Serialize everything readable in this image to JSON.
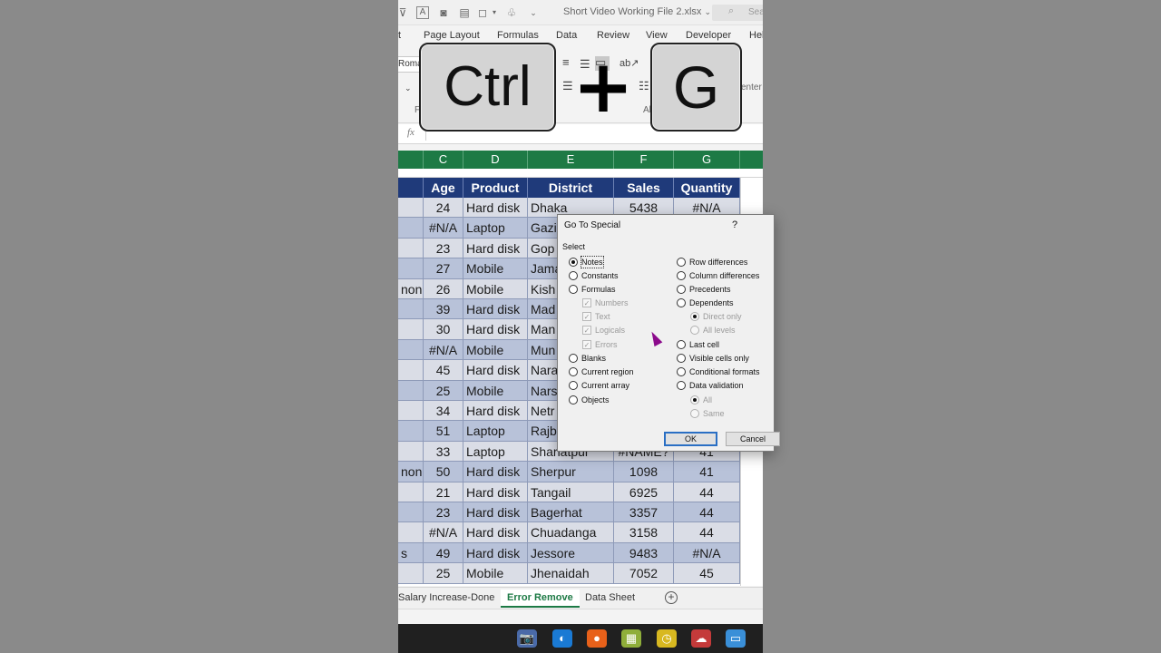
{
  "titlebar": {
    "filename": "Short Video Working File 2.xlsx",
    "dropdown_icon": "chevron-down-icon",
    "search_icon": "search-icon",
    "search_label": "Sear"
  },
  "ribbon_tabs": [
    "t",
    "Page Layout",
    "Formulas",
    "Data",
    "Review",
    "View",
    "Developer",
    "Hel"
  ],
  "ribbon": {
    "font_name": "Roma",
    "group_label_left": "F",
    "group_label_mid": "Al",
    "center_label": "enter"
  },
  "keys": {
    "ctrl": "Ctrl",
    "plus": "+",
    "g": "G"
  },
  "formula_bar": {
    "fx": "fx"
  },
  "columns": [
    "C",
    "D",
    "E",
    "F",
    "G"
  ],
  "table": {
    "headers": [
      "Age",
      "Product",
      "District",
      "Sales",
      "Quantity"
    ],
    "rows": [
      {
        "b": "",
        "age": "24",
        "product": "Hard disk",
        "district": "Dhaka",
        "sales": "5438",
        "qty": "#N/A"
      },
      {
        "b": "",
        "age": "#N/A",
        "product": "Laptop",
        "district": "Gazi",
        "sales": "",
        "qty": ""
      },
      {
        "b": "",
        "age": "23",
        "product": "Hard disk",
        "district": "Gop",
        "sales": "",
        "qty": ""
      },
      {
        "b": "",
        "age": "27",
        "product": "Mobile",
        "district": "Jama",
        "sales": "",
        "qty": ""
      },
      {
        "b": "non",
        "age": "26",
        "product": "Mobile",
        "district": "Kish",
        "sales": "",
        "qty": ""
      },
      {
        "b": "",
        "age": "39",
        "product": "Hard disk",
        "district": "Mad",
        "sales": "",
        "qty": ""
      },
      {
        "b": "",
        "age": "30",
        "product": "Hard disk",
        "district": "Man",
        "sales": "",
        "qty": ""
      },
      {
        "b": "",
        "age": "#N/A",
        "product": "Mobile",
        "district": "Mun",
        "sales": "",
        "qty": ""
      },
      {
        "b": "",
        "age": "45",
        "product": "Hard disk",
        "district": "Nara",
        "sales": "",
        "qty": ""
      },
      {
        "b": "",
        "age": "25",
        "product": "Mobile",
        "district": "Nars",
        "sales": "",
        "qty": ""
      },
      {
        "b": "",
        "age": "34",
        "product": "Hard disk",
        "district": "Netr",
        "sales": "",
        "qty": ""
      },
      {
        "b": "",
        "age": "51",
        "product": "Laptop",
        "district": "Rajb",
        "sales": "",
        "qty": ""
      },
      {
        "b": "",
        "age": "33",
        "product": "Laptop",
        "district": "Shariatpur",
        "sales": "#NAME?",
        "qty": "41"
      },
      {
        "b": "non",
        "age": "50",
        "product": "Hard disk",
        "district": "Sherpur",
        "sales": "1098",
        "qty": "41"
      },
      {
        "b": "",
        "age": "21",
        "product": "Hard disk",
        "district": "Tangail",
        "sales": "6925",
        "qty": "44"
      },
      {
        "b": "",
        "age": "23",
        "product": "Hard disk",
        "district": "Bagerhat",
        "sales": "3357",
        "qty": "44"
      },
      {
        "b": "",
        "age": "#N/A",
        "product": "Hard disk",
        "district": "Chuadanga",
        "sales": "3158",
        "qty": "44"
      },
      {
        "b": "s",
        "age": "49",
        "product": "Hard disk",
        "district": "Jessore",
        "sales": "9483",
        "qty": "#N/A"
      },
      {
        "b": "",
        "age": "25",
        "product": "Mobile",
        "district": "Jhenaidah",
        "sales": "7052",
        "qty": "45"
      }
    ]
  },
  "sheet_tabs": [
    "Salary Increase-Done",
    "Error Remove",
    "Data Sheet"
  ],
  "add_sheet": "+",
  "dialog": {
    "title": "Go To Special",
    "help": "?",
    "group_label": "Select",
    "left_options": [
      {
        "label": "Notes",
        "selected": true,
        "disabled": false,
        "type": "radio",
        "ul": "N"
      },
      {
        "label": "Constants",
        "selected": false,
        "disabled": false,
        "type": "radio",
        "ul": "o"
      },
      {
        "label": "Formulas",
        "selected": false,
        "disabled": false,
        "type": "radio",
        "ul": "F"
      },
      {
        "label": "Numbers",
        "selected": false,
        "disabled": true,
        "type": "check",
        "ul": "U"
      },
      {
        "label": "Text",
        "selected": false,
        "disabled": true,
        "type": "check",
        "ul": "X"
      },
      {
        "label": "Logicals",
        "selected": false,
        "disabled": true,
        "type": "check",
        "ul": "G"
      },
      {
        "label": "Errors",
        "selected": false,
        "disabled": true,
        "type": "check",
        "ul": "E"
      },
      {
        "label": "Blanks",
        "selected": false,
        "disabled": false,
        "type": "radio",
        "ul": "k"
      },
      {
        "label": "Current region",
        "selected": false,
        "disabled": false,
        "type": "radio",
        "ul": "r"
      },
      {
        "label": "Current array",
        "selected": false,
        "disabled": false,
        "type": "radio",
        "ul": "a"
      },
      {
        "label": "Objects",
        "selected": false,
        "disabled": false,
        "type": "radio",
        "ul": "b"
      }
    ],
    "right_options": [
      {
        "label": "Row differences",
        "selected": false,
        "disabled": false,
        "type": "radio",
        "ul": "w"
      },
      {
        "label": "Column differences",
        "selected": false,
        "disabled": false,
        "type": "radio",
        "ul": "M"
      },
      {
        "label": "Precedents",
        "selected": false,
        "disabled": false,
        "type": "radio",
        "ul": "P"
      },
      {
        "label": "Dependents",
        "selected": false,
        "disabled": false,
        "type": "radio",
        "ul": "D"
      },
      {
        "label": "Direct only",
        "selected": true,
        "disabled": true,
        "type": "radio",
        "ul": "I"
      },
      {
        "label": "All levels",
        "selected": false,
        "disabled": true,
        "type": "radio",
        "ul": "L"
      },
      {
        "label": "Last cell",
        "selected": false,
        "disabled": false,
        "type": "radio",
        "ul": "S"
      },
      {
        "label": "Visible cells only",
        "selected": false,
        "disabled": false,
        "type": "radio",
        "ul": "y"
      },
      {
        "label": "Conditional formats",
        "selected": false,
        "disabled": false,
        "type": "radio",
        "ul": "T"
      },
      {
        "label": "Data validation",
        "selected": false,
        "disabled": false,
        "type": "radio",
        "ul": "V"
      },
      {
        "label": "All",
        "selected": true,
        "disabled": true,
        "type": "radio",
        "ul": "l"
      },
      {
        "label": "Same",
        "selected": false,
        "disabled": true,
        "type": "radio",
        "ul": "e"
      }
    ],
    "ok_label": "OK",
    "cancel_label": "Cancel"
  },
  "taskbar": [
    {
      "icon": "camera-icon",
      "glyph": "📷",
      "color": "#4a6aa8"
    },
    {
      "icon": "edge-browser-icon",
      "glyph": "◐",
      "color": "#1a7ad4"
    },
    {
      "icon": "firefox-icon",
      "glyph": "●",
      "color": "#e8611a"
    },
    {
      "icon": "image-app-icon",
      "glyph": "▦",
      "color": "#8fae3a"
    },
    {
      "icon": "clock-app-icon",
      "glyph": "◷",
      "color": "#d8b820"
    },
    {
      "icon": "network-app-icon",
      "glyph": "☁",
      "color": "#c43a3a"
    },
    {
      "icon": "drive-app-icon",
      "glyph": "▭",
      "color": "#3a8fd8"
    }
  ],
  "colors": {
    "excel_green": "#1d7a45",
    "header_navy": "#1f3a7a",
    "row_light": "#dadde6",
    "row_dark": "#b8c2d9",
    "cursor": "#8b0a8b"
  }
}
